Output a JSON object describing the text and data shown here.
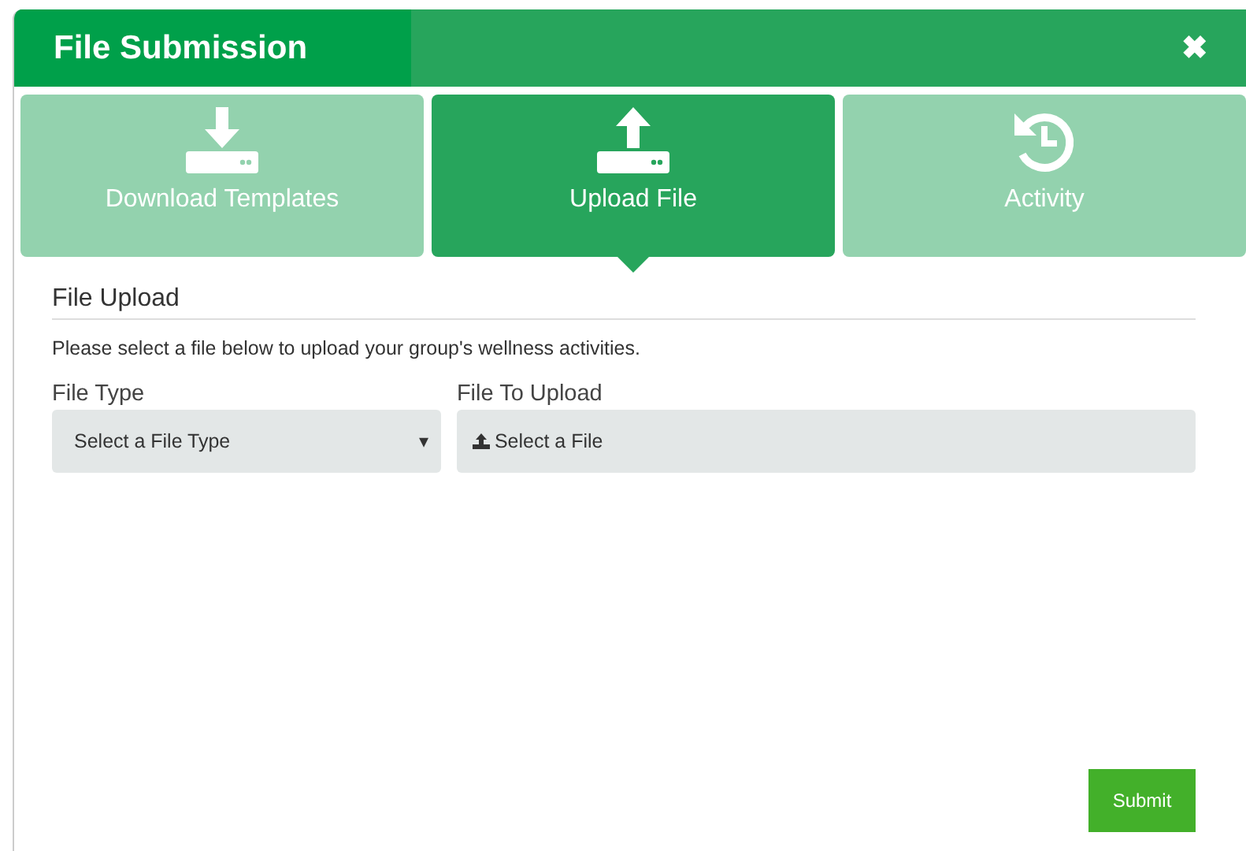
{
  "window": {
    "title": "File Submission",
    "close": "✖"
  },
  "tabs": [
    {
      "label": "Download Templates",
      "kind": "download",
      "selected": false
    },
    {
      "label": "Upload File",
      "kind": "upload",
      "selected": true
    },
    {
      "label": "Activity",
      "kind": "history",
      "selected": false
    }
  ],
  "section": {
    "title": "File Upload",
    "description": "Please select a file below to upload your group's wellness activities."
  },
  "fields": [
    {
      "label": "File Type",
      "kind": "select",
      "value": "Select a File Type",
      "caret": "▾"
    },
    {
      "label": "File To Upload",
      "kind": "file",
      "value": "Select a File"
    }
  ],
  "buttons": [
    {
      "label": "Submit"
    }
  ]
}
